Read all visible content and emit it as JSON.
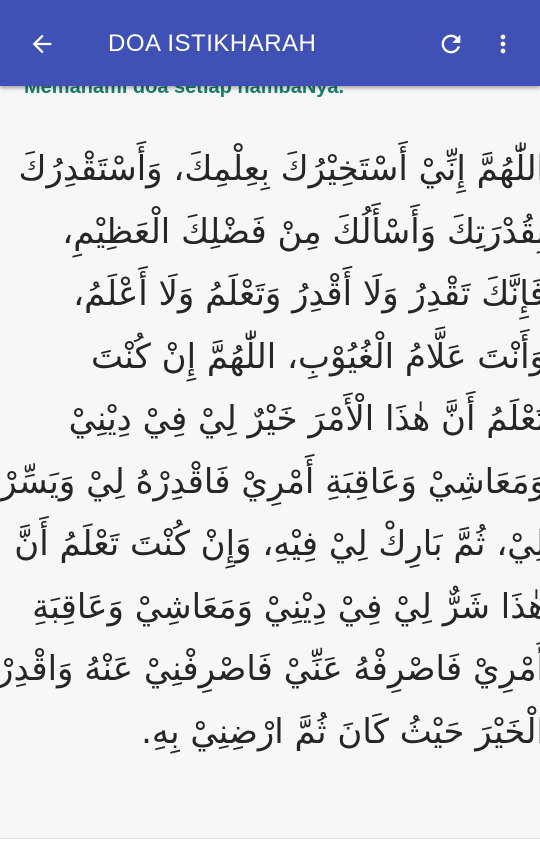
{
  "appbar": {
    "title": "DOA ISTIKHARAH",
    "background": "#3f51b5",
    "icons": {
      "back": "arrow-back-icon",
      "refresh": "refresh-icon",
      "more": "more-vert-icon"
    }
  },
  "content": {
    "subtitle": "Memahami doa setiap hambaNya.",
    "subtitle_color": "#1a7f6e",
    "arabic_lines": [
      "اللّٰهُمَّ إِنِّيْ أَسْتَخِيْرُكَ بِعِلْمِكَ، وَأَسْتَقْدِرُكَ",
      "بِقُدْرَتِكَ وَأَسْأَلُكَ مِنْ فَضْلِكَ الْعَظِيْمِ،",
      "فَإِنَّكَ تَقْدِرُ وَلَا أَقْدِرُ وَتَعْلَمُ وَلَا أَعْلَمُ،",
      "وَأَنْتَ عَلَّامُ الْغُيُوْبِ، اللّٰهُمَّ إِنْ كُنْتَ",
      "تَعْلَمُ أَنَّ هٰذَا الْأَمْرَ خَيْرٌ لِيْ فِيْ دِيْنِيْ",
      "وَمَعَاشِيْ وَعَاقِبَةِ أَمْرِيْ فَاقْدِرْهُ لِيْ وَيَسِّرْهُ",
      "لِيْ، ثُمَّ بَارِكْ لِيْ فِيْهِ، وَإِنْ كُنْتَ تَعْلَمُ أَنَّ",
      "هٰذَا شَرٌّ لِيْ فِيْ دِيْنِيْ وَمَعَاشِيْ وَعَاقِبَةِ",
      "أَمْرِيْ فَاصْرِفْهُ عَنِّيْ فَاصْرِفْنِيْ عَنْهُ وَاقْدِرْلِيَ",
      "الْخَيْرَ حَيْثُ كَانَ ثُمَّ ارْضِنِيْ بِهِ."
    ]
  }
}
